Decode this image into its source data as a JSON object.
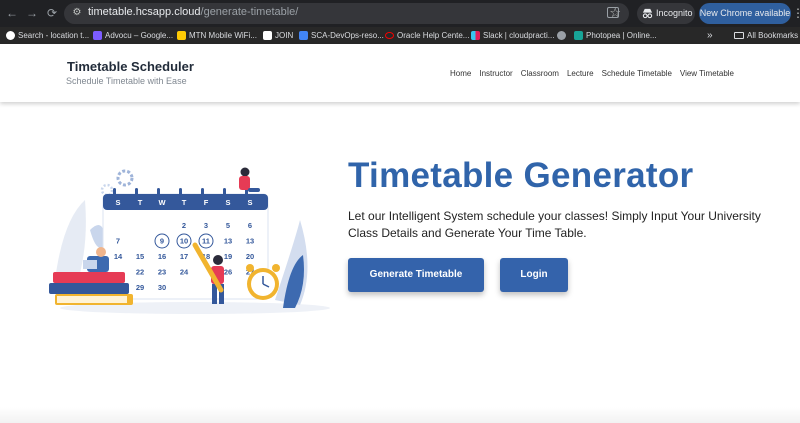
{
  "browser": {
    "url_host": "timetable.hcsapp.cloud",
    "url_path": "/generate-timetable/",
    "incognito_label": "Incognito",
    "update_label": "New Chrome available",
    "nav_back": "←",
    "nav_forward": "→",
    "nav_reload": "⟳",
    "star": "☆",
    "kebab": "⋮",
    "more": "»",
    "bookmarks": [
      {
        "label": "Search - location t...",
        "icon": "github-icon",
        "color": "#ffffff"
      },
      {
        "label": "Advocu – Google...",
        "icon": "advocu-icon",
        "color": "#7c5cff"
      },
      {
        "label": "MTN Mobile WiFi...",
        "icon": "mtn-icon",
        "color": "#ffcb05"
      },
      {
        "label": "JOIN",
        "icon": "join-icon",
        "color": "#ffffff"
      },
      {
        "label": "SCA-DevOps-reso...",
        "icon": "docs-icon",
        "color": "#4285f4"
      },
      {
        "label": "Oracle Help Cente...",
        "icon": "oracle-icon",
        "color": "#f80000"
      },
      {
        "label": "Slack | cloudpracti...",
        "icon": "slack-icon",
        "color": "#e01e5a"
      },
      {
        "label": "",
        "icon": "globe-icon",
        "color": "#9aa0a6"
      },
      {
        "label": "Photopea | Online...",
        "icon": "photopea-icon",
        "color": "#18a497"
      }
    ],
    "all_bookmarks": "All Bookmarks"
  },
  "site": {
    "title": "Timetable Scheduler",
    "subtitle": "Schedule Timetable with Ease",
    "nav": [
      "Home",
      "Instructor",
      "Classroom",
      "Lecture",
      "Schedule Timetable",
      "View Timetable"
    ]
  },
  "hero": {
    "title": "Timetable Generator",
    "description": "Let our Intelligent System schedule your classes! Simply Input Your University Class Details and Generate Your Time Table.",
    "primary_button": "Generate Timetable",
    "secondary_button": "Login"
  },
  "calendar": {
    "weekdays": [
      "S",
      "T",
      "W",
      "T",
      "F",
      "S",
      "S"
    ],
    "rows": [
      [
        "",
        "",
        "",
        "2",
        "3",
        "5",
        "6"
      ],
      [
        "7",
        "",
        "9",
        "10",
        "11",
        "13",
        "13"
      ],
      [
        "14",
        "15",
        "16",
        "17",
        "18",
        "19",
        "20"
      ],
      [
        "",
        "22",
        "23",
        "24",
        "",
        "26",
        "27"
      ],
      [
        "",
        "29",
        "30",
        "",
        "",
        "",
        ""
      ]
    ]
  },
  "colors": {
    "accent": "#3064aa",
    "button": "#3463ab",
    "calendar_header": "#34589b",
    "person_shirt": "#e63b55"
  }
}
